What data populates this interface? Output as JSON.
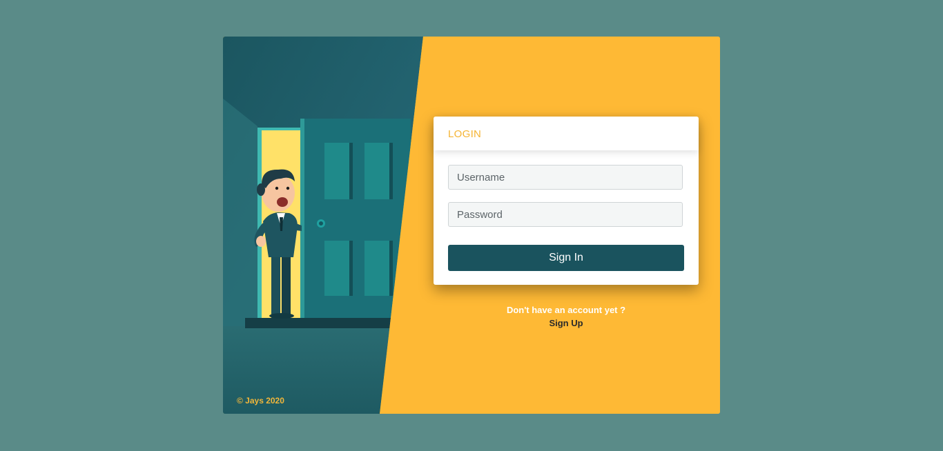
{
  "login": {
    "title": "LOGIN",
    "username_placeholder": "Username",
    "password_placeholder": "Password",
    "signin_label": "Sign In"
  },
  "signup": {
    "prompt": "Don't have an account yet ?",
    "link_label": "Sign Up"
  },
  "footer": {
    "credit": "© Jays 2020"
  },
  "colors": {
    "page_background": "#5a8b88",
    "accent_yellow": "#feb935",
    "button_teal": "#1a535e",
    "title_orange": "#f5b433"
  }
}
